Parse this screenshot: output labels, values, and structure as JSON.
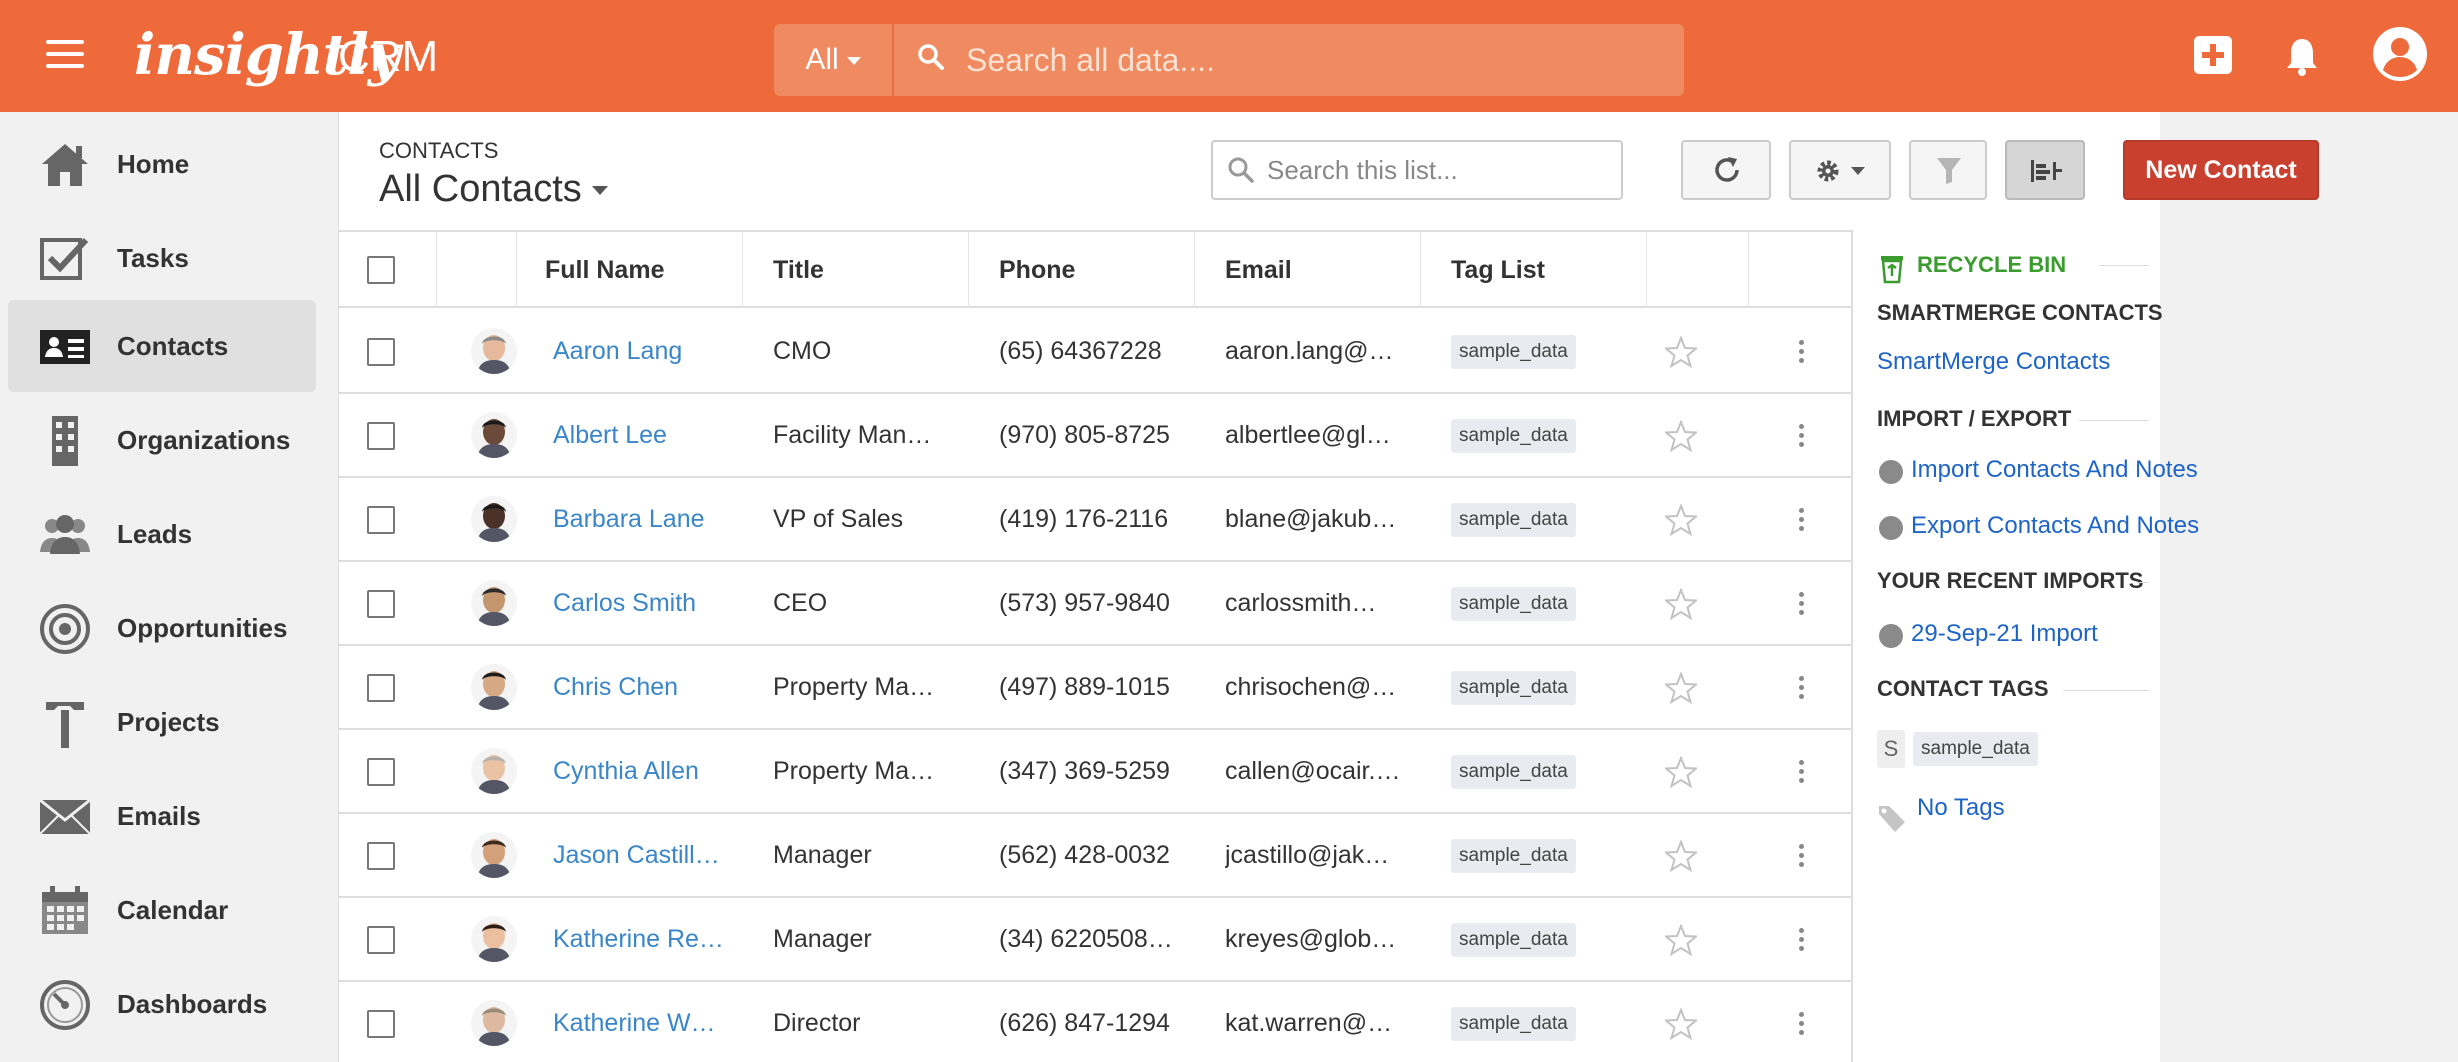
{
  "topbar": {
    "logo": "insightly",
    "product": "CRM",
    "search_scope": "All",
    "search_placeholder": "Search all data...."
  },
  "sidebar": {
    "items": [
      {
        "label": "Home",
        "icon": "home-icon"
      },
      {
        "label": "Tasks",
        "icon": "tasks-icon"
      },
      {
        "label": "Contacts",
        "icon": "contacts-icon",
        "active": true
      },
      {
        "label": "Organizations",
        "icon": "organizations-icon"
      },
      {
        "label": "Leads",
        "icon": "leads-icon"
      },
      {
        "label": "Opportunities",
        "icon": "opportunities-icon"
      },
      {
        "label": "Projects",
        "icon": "projects-icon"
      },
      {
        "label": "Emails",
        "icon": "emails-icon"
      },
      {
        "label": "Calendar",
        "icon": "calendar-icon"
      },
      {
        "label": "Dashboards",
        "icon": "dashboards-icon"
      }
    ]
  },
  "main": {
    "breadcrumb": "CONTACTS",
    "view_title": "All Contacts",
    "list_search_placeholder": "Search this list...",
    "new_button": "New Contact"
  },
  "table": {
    "columns": [
      "Full Name",
      "Title",
      "Phone",
      "Email",
      "Tag List"
    ],
    "rows": [
      {
        "name": "Aaron Lang",
        "title": "CMO",
        "phone": "(65) 64367228",
        "email": "aaron.lang@…",
        "tag": "sample_data"
      },
      {
        "name": "Albert Lee",
        "title": "Facility Man…",
        "phone": "(970) 805-8725",
        "email": "albertlee@gl…",
        "tag": "sample_data"
      },
      {
        "name": "Barbara Lane",
        "title": "VP of Sales",
        "phone": "(419) 176-2116",
        "email": "blane@jakub…",
        "tag": "sample_data"
      },
      {
        "name": "Carlos Smith",
        "title": "CEO",
        "phone": "(573) 957-9840",
        "email": "carlossmith…",
        "tag": "sample_data"
      },
      {
        "name": "Chris Chen",
        "title": "Property Ma…",
        "phone": "(497) 889-1015",
        "email": "chrisochen@…",
        "tag": "sample_data"
      },
      {
        "name": "Cynthia Allen",
        "title": "Property Ma…",
        "phone": "(347) 369-5259",
        "email": "callen@ocair.…",
        "tag": "sample_data"
      },
      {
        "name": "Jason Castill…",
        "title": "Manager",
        "phone": "(562) 428-0032",
        "email": "jcastillo@jak…",
        "tag": "sample_data"
      },
      {
        "name": "Katherine Re…",
        "title": "Manager",
        "phone": "(34) 6220508…",
        "email": "kreyes@glob…",
        "tag": "sample_data"
      },
      {
        "name": "Katherine W…",
        "title": "Director",
        "phone": "(626) 847-1294",
        "email": "kat.warren@…",
        "tag": "sample_data"
      }
    ]
  },
  "right_panel": {
    "recycle_bin": "RECYCLE BIN",
    "smartmerge_heading": "SMARTMERGE CONTACTS",
    "smartmerge_link": "SmartMerge Contacts",
    "import_export_heading": "IMPORT / EXPORT",
    "import_link": "Import Contacts And Notes",
    "export_link": "Export Contacts And Notes",
    "recent_imports_heading": "YOUR RECENT IMPORTS",
    "recent_import_link": "29-Sep-21 Import",
    "contact_tags_heading": "CONTACT TAGS",
    "tag_letter": "S",
    "tag_name": "sample_data",
    "no_tags": "No Tags"
  },
  "colors": {
    "brand_orange": "#ee6a3a",
    "new_button_red": "#c9402f",
    "link_blue": "#3a86c8",
    "recycle_green": "#3b9b2e"
  }
}
